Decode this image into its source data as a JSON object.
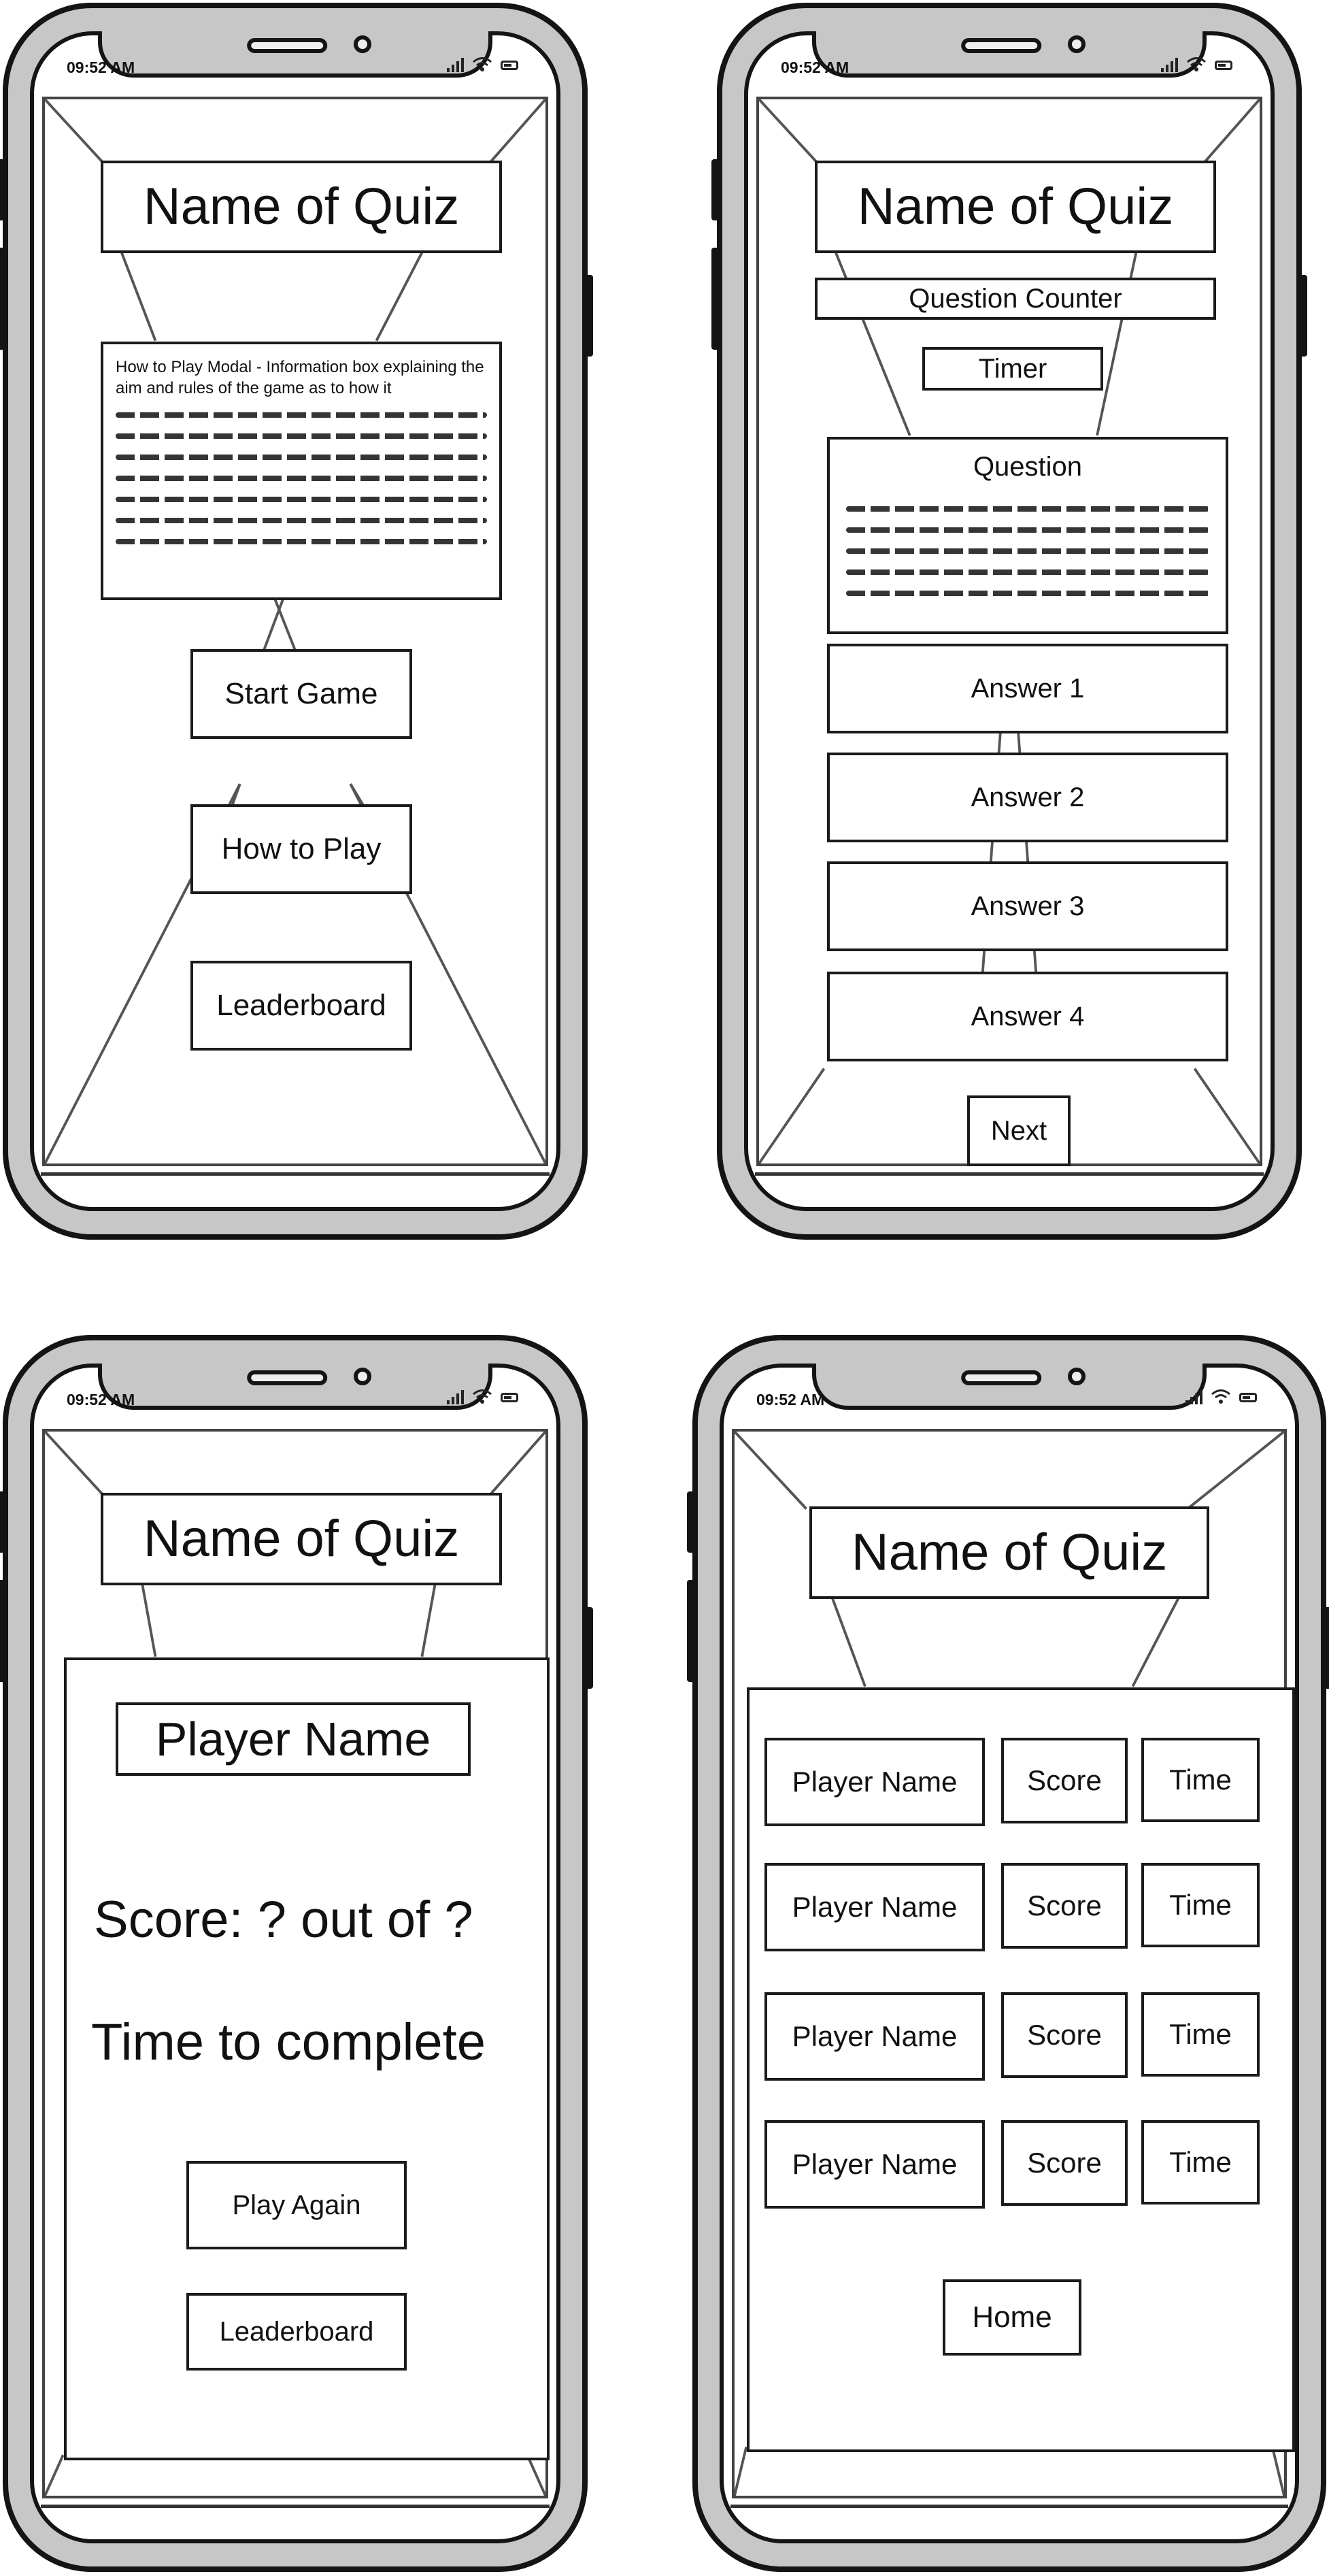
{
  "status": {
    "time": "09:52 AM"
  },
  "screens": {
    "home": {
      "title": "Name of Quiz",
      "modal_title": "How to Play Modal - Information box explaining the aim and rules of the game as to how it",
      "start_button": "Start Game",
      "how_to_button": "How to Play",
      "leaderboard_button": "Leaderboard"
    },
    "quiz": {
      "title": "Name of Quiz",
      "question_counter": "Question Counter",
      "timer": "Timer",
      "question_label": "Question",
      "answers": [
        "Answer 1",
        "Answer 2",
        "Answer 3",
        "Answer 4"
      ],
      "next_button": "Next"
    },
    "result": {
      "title": "Name of Quiz",
      "player_name": "Player Name",
      "score": "Score: ? out of ?",
      "time_to_complete": "Time to complete",
      "play_again_button": "Play Again",
      "leaderboard_button": "Leaderboard"
    },
    "leaderboard": {
      "title": "Name of Quiz",
      "rows": [
        {
          "player": "Player Name",
          "score": "Score",
          "time": "Time"
        },
        {
          "player": "Player Name",
          "score": "Score",
          "time": "Time"
        },
        {
          "player": "Player Name",
          "score": "Score",
          "time": "Time"
        },
        {
          "player": "Player Name",
          "score": "Score",
          "time": "Time"
        }
      ],
      "home_button": "Home"
    }
  },
  "icons": [
    "signal-icon",
    "wifi-icon",
    "battery-icon"
  ]
}
